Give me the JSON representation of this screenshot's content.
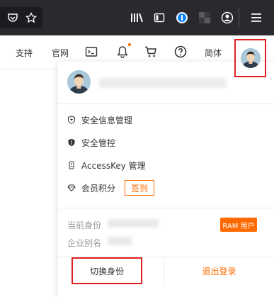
{
  "header": {
    "nav": {
      "support": "支持",
      "official_site": "官网",
      "language": "简体"
    },
    "icons": [
      "terminal-icon",
      "bell-icon",
      "cart-icon",
      "help-icon"
    ],
    "notification_dot_color": "#ff6a00"
  },
  "dropdown": {
    "menu": {
      "security_info": "安全信息管理",
      "security_control": "安全管控",
      "accesskey": "AccessKey 管理",
      "points": "会员积分",
      "sign_in": "签到"
    },
    "info": {
      "current_identity_label": "当前身份",
      "ram_badge": "RAM 用户",
      "enterprise_alias_label": "企业别名"
    },
    "footer": {
      "switch_identity": "切换身份",
      "logout": "退出登录"
    }
  },
  "colors": {
    "accent": "#ff6a00",
    "highlight_box": "#e02020",
    "toolbar_bg": "#2a2a2e"
  }
}
